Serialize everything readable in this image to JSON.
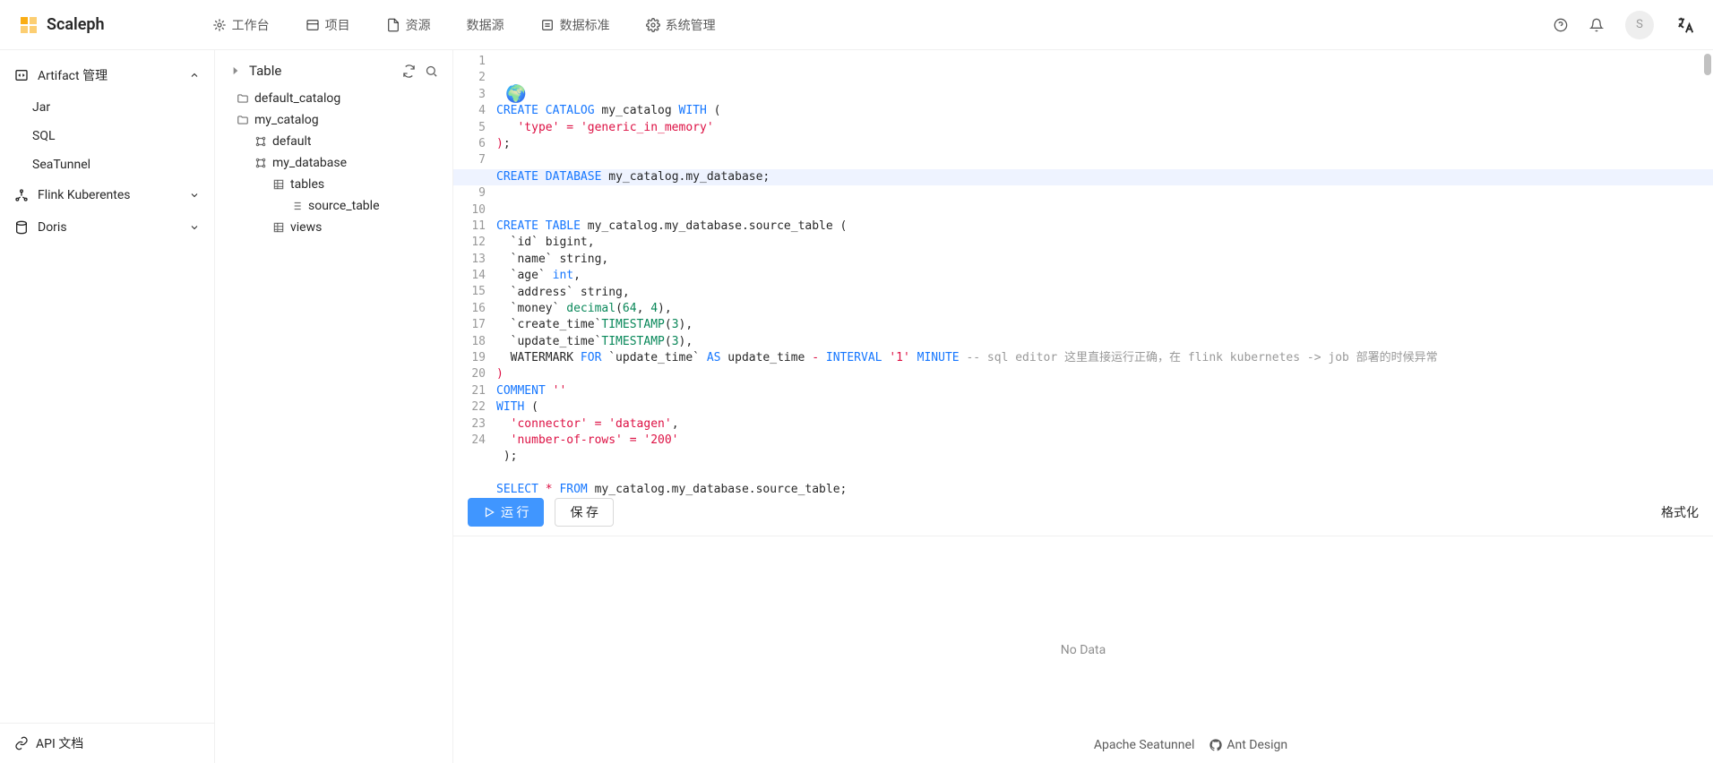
{
  "app": {
    "name": "Scaleph",
    "avatar_initial": "S"
  },
  "nav": {
    "workspace": "工作台",
    "project": "项目",
    "resource": "资源",
    "datasource": "数据源",
    "datastandard": "数据标准",
    "system": "系统管理"
  },
  "sidebar": {
    "artifact": {
      "label": "Artifact 管理",
      "jar": "Jar",
      "sql": "SQL",
      "seatunnel": "SeaTunnel"
    },
    "flink": "Flink Kuberentes",
    "doris": "Doris",
    "api_doc": "API 文档"
  },
  "tree": {
    "title": "Table",
    "nodes": {
      "default_catalog": "default_catalog",
      "my_catalog": "my_catalog",
      "default": "default",
      "my_database": "my_database",
      "tables": "tables",
      "source_table": "source_table",
      "views": "views"
    }
  },
  "editor": {
    "lines": [
      {
        "n": 1,
        "t": [
          [
            "kw",
            "CREATE"
          ],
          [
            "",
            " "
          ],
          [
            "kw",
            "CATALOG"
          ],
          [
            "",
            " my_catalog "
          ],
          [
            "kw",
            "WITH"
          ],
          [
            "",
            " ("
          ]
        ]
      },
      {
        "n": 2,
        "t": [
          [
            "",
            "   "
          ],
          [
            "str",
            "'type'"
          ],
          [
            "",
            " "
          ],
          [
            "op",
            "="
          ],
          [
            "",
            " "
          ],
          [
            "str",
            "'generic_in_memory'"
          ]
        ]
      },
      {
        "n": 3,
        "t": [
          [
            "op",
            ")"
          ],
          [
            "",
            ";"
          ]
        ]
      },
      {
        "n": 4,
        "t": [
          [
            "",
            ""
          ]
        ]
      },
      {
        "n": 5,
        "hl": true,
        "t": [
          [
            "kw",
            "CREATE"
          ],
          [
            "",
            " "
          ],
          [
            "kw",
            "DATABASE"
          ],
          [
            "",
            " my_catalog.my_database;"
          ]
        ]
      },
      {
        "n": 6,
        "t": [
          [
            "",
            ""
          ]
        ]
      },
      {
        "n": 7,
        "t": [
          [
            "",
            ""
          ]
        ]
      },
      {
        "n": 8,
        "t": [
          [
            "kw",
            "CREATE"
          ],
          [
            "",
            " "
          ],
          [
            "kw",
            "TABLE"
          ],
          [
            "",
            " my_catalog.my_database.source_table ("
          ]
        ]
      },
      {
        "n": 9,
        "t": [
          [
            "",
            "  `id` bigint,"
          ]
        ]
      },
      {
        "n": 10,
        "t": [
          [
            "",
            "  `name` string,"
          ]
        ]
      },
      {
        "n": 11,
        "t": [
          [
            "",
            "  `age` "
          ],
          [
            "kw",
            "int"
          ],
          [
            "",
            ","
          ]
        ]
      },
      {
        "n": 12,
        "t": [
          [
            "",
            "  `address` string,"
          ]
        ]
      },
      {
        "n": 13,
        "t": [
          [
            "",
            "  `money` "
          ],
          [
            "fn",
            "decimal"
          ],
          [
            "",
            "("
          ],
          [
            "num",
            "64"
          ],
          [
            "",
            ", "
          ],
          [
            "num",
            "4"
          ],
          [
            "",
            "),"
          ]
        ]
      },
      {
        "n": 14,
        "t": [
          [
            "",
            "  `create_time`"
          ],
          [
            "fn",
            "TIMESTAMP"
          ],
          [
            "",
            "("
          ],
          [
            "num",
            "3"
          ],
          [
            "",
            "),"
          ]
        ]
      },
      {
        "n": 15,
        "t": [
          [
            "",
            "  `update_time`"
          ],
          [
            "fn",
            "TIMESTAMP"
          ],
          [
            "",
            "("
          ],
          [
            "num",
            "3"
          ],
          [
            "",
            "),"
          ]
        ]
      },
      {
        "n": 16,
        "t": [
          [
            "",
            "  WATERMARK "
          ],
          [
            "kw",
            "FOR"
          ],
          [
            "",
            " `update_time` "
          ],
          [
            "kw",
            "AS"
          ],
          [
            "",
            " update_time "
          ],
          [
            "op",
            "-"
          ],
          [
            "",
            " "
          ],
          [
            "kw",
            "INTERVAL"
          ],
          [
            "",
            " "
          ],
          [
            "str",
            "'1'"
          ],
          [
            "",
            " "
          ],
          [
            "kw",
            "MINUTE"
          ],
          [
            "",
            " "
          ],
          [
            "cmt",
            "-- sql editor 这里直接运行正确，在 flink kubernetes -> job 部署的时候异常"
          ]
        ]
      },
      {
        "n": 17,
        "t": [
          [
            "op",
            ")"
          ]
        ]
      },
      {
        "n": 18,
        "t": [
          [
            "kw",
            "COMMENT"
          ],
          [
            "",
            " "
          ],
          [
            "str",
            "''"
          ]
        ]
      },
      {
        "n": 19,
        "t": [
          [
            "kw",
            "WITH"
          ],
          [
            "",
            " ("
          ]
        ]
      },
      {
        "n": 20,
        "t": [
          [
            "",
            "  "
          ],
          [
            "str",
            "'connector'"
          ],
          [
            "",
            " "
          ],
          [
            "op",
            "="
          ],
          [
            "",
            " "
          ],
          [
            "str",
            "'datagen'"
          ],
          [
            "",
            ","
          ]
        ]
      },
      {
        "n": 21,
        "t": [
          [
            "",
            "  "
          ],
          [
            "str",
            "'number-of-rows'"
          ],
          [
            "",
            " "
          ],
          [
            "op",
            "="
          ],
          [
            "",
            " "
          ],
          [
            "str",
            "'200'"
          ]
        ]
      },
      {
        "n": 22,
        "t": [
          [
            "",
            " );"
          ]
        ]
      },
      {
        "n": 23,
        "t": [
          [
            "",
            ""
          ]
        ]
      },
      {
        "n": 24,
        "t": [
          [
            "kw",
            "SELECT"
          ],
          [
            "",
            " "
          ],
          [
            "op",
            "*"
          ],
          [
            "",
            " "
          ],
          [
            "kw",
            "FROM"
          ],
          [
            "",
            " my_catalog.my_database.source_table;"
          ]
        ]
      }
    ]
  },
  "toolbar": {
    "run": "运 行",
    "save": "保 存",
    "format": "格式化"
  },
  "results": {
    "empty": "No Data"
  },
  "footer": {
    "seatunnel": "Apache Seatunnel",
    "ant": "Ant Design"
  }
}
